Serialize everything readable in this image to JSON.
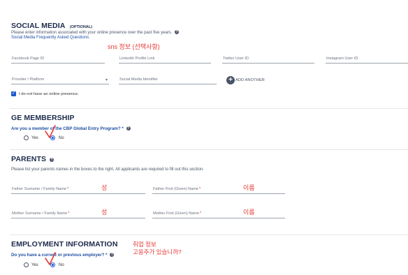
{
  "social": {
    "title": "SOCIAL MEDIA",
    "optional": "(OPTIONAL)",
    "description": "Please enter information associated with your online presence over the past five years.",
    "faq_link": "Social Media Frequently Asked Questions.",
    "annotation": "sns 정보 (선택사항)",
    "fields": {
      "facebook": "Facebook Page ID",
      "linkedin": "LinkedIn Profile Link",
      "twitter": "Twitter User ID",
      "instagram": "Instagram User ID",
      "provider": "Provider / Platform",
      "identifier": "Social Media Identifier"
    },
    "add_another": "ADD ANOTHER",
    "no_presence": "I do not have an online presence."
  },
  "ge": {
    "title": "GE MEMBERSHIP",
    "question": "Are you a member of the CBP Global Entry Program? *",
    "yes": "Yes",
    "no": "No",
    "selected": "No"
  },
  "parents": {
    "title": "PARENTS",
    "description": "Please list your parents names in the boxes to the right. All applicants are required to fill out this section.",
    "father_surname": "Father Surname / Family Name",
    "father_given": "Father First (Given) Name",
    "mother_surname": "Mother Surname / Family Name",
    "mother_given": "Mother First (Given) Name",
    "required_mark": "*",
    "annotation_surname": "성",
    "annotation_given": "이름"
  },
  "employment": {
    "title": "EMPLOYMENT INFORMATION",
    "question": "Do you have a current or previous employer? *",
    "yes": "Yes",
    "no": "No",
    "selected": "No",
    "annotation_line1": "취업 정보",
    "annotation_line2": "고용주가 있습니까?"
  },
  "colors": {
    "heading": "#1b2a4a",
    "accent": "#1f5bd0",
    "annotation": "#e53935"
  }
}
